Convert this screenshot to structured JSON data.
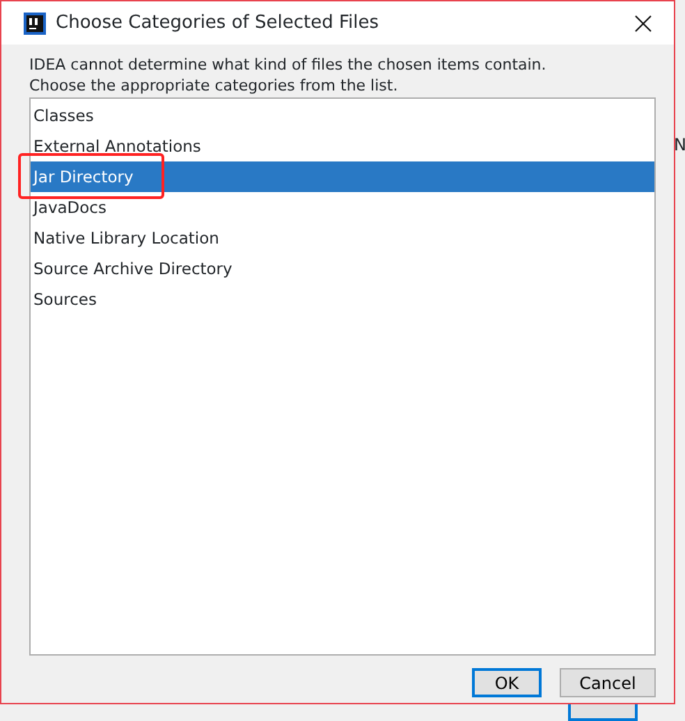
{
  "background_window": {
    "label_fragment": "N"
  },
  "dialog": {
    "title": "Choose Categories of Selected Files",
    "message": [
      "IDEA cannot determine what kind of files the chosen items contain.",
      "Choose the appropriate categories from the list."
    ],
    "categories": [
      {
        "label": "Classes",
        "selected": false
      },
      {
        "label": "External Annotations",
        "selected": false
      },
      {
        "label": "Jar Directory",
        "selected": true
      },
      {
        "label": "JavaDocs",
        "selected": false
      },
      {
        "label": "Native Library Location",
        "selected": false
      },
      {
        "label": "Source Archive Directory",
        "selected": false
      },
      {
        "label": "Sources",
        "selected": false
      }
    ],
    "buttons": [
      {
        "label": "OK",
        "default": true
      },
      {
        "label": "Cancel",
        "default": false
      }
    ]
  }
}
